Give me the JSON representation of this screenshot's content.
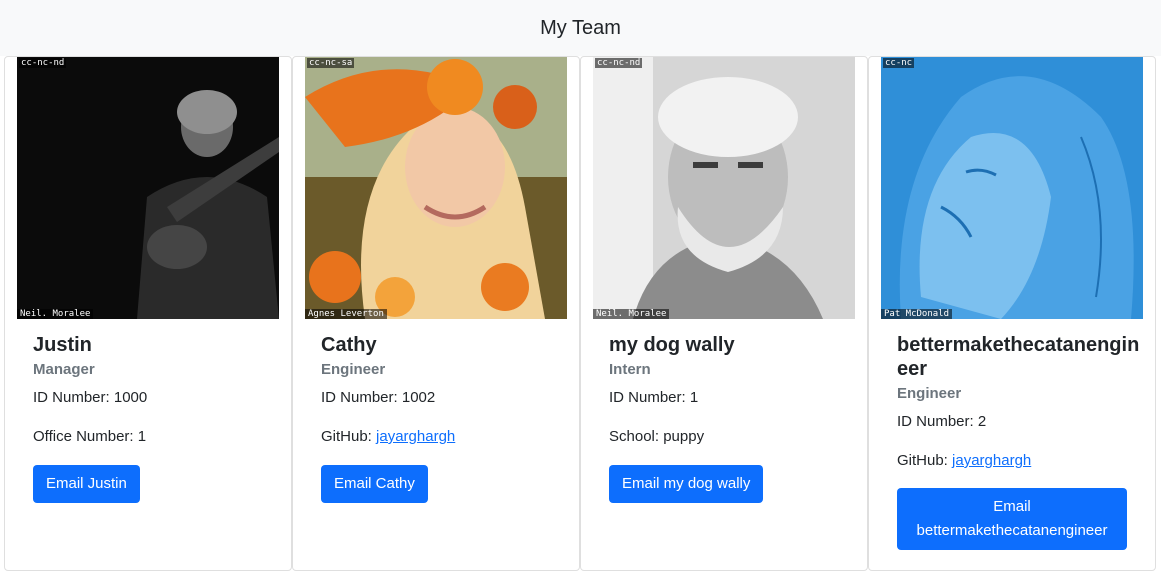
{
  "header": {
    "title": "My Team"
  },
  "employees": [
    {
      "name": "Justin",
      "role": "Manager",
      "id_text": "ID Number: 1000",
      "extra_label": "Office Number: 1",
      "extra_link": "",
      "email_button": "Email Justin",
      "photo": {
        "license": "cc-nc-nd",
        "credit": "Neil. Moralee"
      }
    },
    {
      "name": "Cathy",
      "role": "Engineer",
      "id_text": "ID Number: 1002",
      "extra_label": "GitHub: ",
      "extra_link": "jayarghargh",
      "email_button": "Email Cathy",
      "photo": {
        "license": "cc-nc-sa",
        "credit": "Agnes Leverton"
      }
    },
    {
      "name": "my dog wally",
      "role": "Intern",
      "id_text": "ID Number: 1",
      "extra_label": "School: puppy",
      "extra_link": "",
      "email_button": "Email my dog wally",
      "photo": {
        "license": "cc-nc-nd",
        "credit": "Neil. Moralee"
      }
    },
    {
      "name": "bettermakethecatanengineer",
      "role": "Engineer",
      "id_text": "ID Number: 2",
      "extra_label": "GitHub: ",
      "extra_link": "jayarghargh",
      "email_button": "Email bettermakethecatanengineer",
      "photo": {
        "license": "cc-nc",
        "credit": "Pat McDonald"
      }
    }
  ]
}
